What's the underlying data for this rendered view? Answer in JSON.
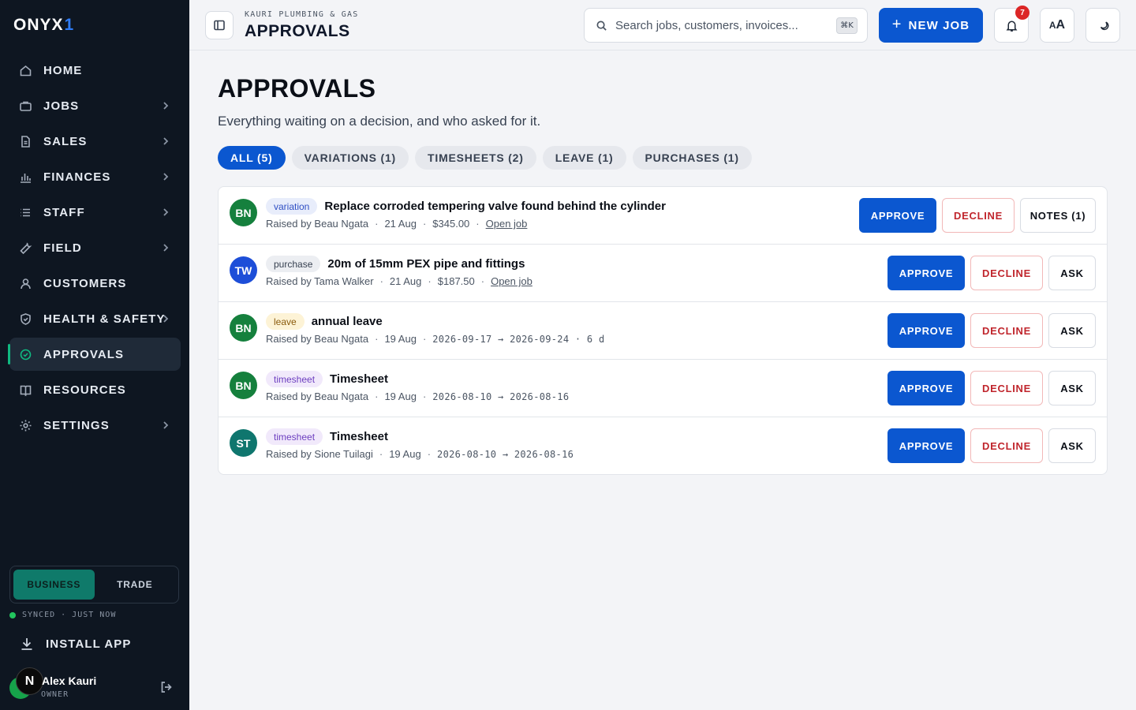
{
  "sidebar": {
    "logo": {
      "text": "ONYX",
      "accent": "1"
    },
    "items": [
      {
        "label": "HOME",
        "icon": "home-icon",
        "chevron": false,
        "active": false
      },
      {
        "label": "JOBS",
        "icon": "briefcase-icon",
        "chevron": true,
        "active": false
      },
      {
        "label": "SALES",
        "icon": "document-icon",
        "chevron": true,
        "active": false
      },
      {
        "label": "FINANCES",
        "icon": "bar-chart-icon",
        "chevron": true,
        "active": false
      },
      {
        "label": "STAFF",
        "icon": "list-icon",
        "chevron": true,
        "active": false
      },
      {
        "label": "FIELD",
        "icon": "wrench-icon",
        "chevron": true,
        "active": false
      },
      {
        "label": "CUSTOMERS",
        "icon": "user-icon",
        "chevron": false,
        "active": false
      },
      {
        "label": "HEALTH & SAFETY",
        "icon": "shield-icon",
        "chevron": true,
        "active": false
      },
      {
        "label": "APPROVALS",
        "icon": "check-circle-icon",
        "chevron": false,
        "active": true
      },
      {
        "label": "RESOURCES",
        "icon": "book-icon",
        "chevron": false,
        "active": false
      },
      {
        "label": "SETTINGS",
        "icon": "gear-icon",
        "chevron": true,
        "active": false
      }
    ],
    "mode": {
      "business": "BUSINESS",
      "trade": "TRADE",
      "selected": "BUSINESS"
    },
    "sync_status": "SYNCED · JUST NOW",
    "install_label": "INSTALL APP",
    "user": {
      "name": "Alex Kauri",
      "role": "OWNER",
      "badge": "N"
    }
  },
  "topbar": {
    "company": "KAURI PLUMBING & GAS",
    "title": "APPROVALS",
    "search_placeholder": "Search jobs, customers, invoices...",
    "search_shortcut": "⌘K",
    "new_job_label": "NEW JOB",
    "notification_count": "7",
    "text_size_label_small": "A",
    "text_size_label_big": "A"
  },
  "page": {
    "title": "APPROVALS",
    "subtitle": "Everything waiting on a decision, and who asked for it.",
    "tabs": [
      {
        "label": "ALL (5)",
        "selected": true
      },
      {
        "label": "VARIATIONS (1)",
        "selected": false
      },
      {
        "label": "TIMESHEETS (2)",
        "selected": false
      },
      {
        "label": "LEAVE (1)",
        "selected": false
      },
      {
        "label": "PURCHASES (1)",
        "selected": false
      }
    ]
  },
  "approvals": [
    {
      "initials": "BN",
      "avatar_color": "#15803d",
      "tag": "variation",
      "tag_bg": "#e8edfb",
      "tag_color": "#2f4fc4",
      "title": "Replace corroded tempering valve found behind the cylinder",
      "raised_by": "Raised by Beau Ngata",
      "date": "21 Aug",
      "detail": "$345.00",
      "link": "Open job",
      "approve": "APPROVE",
      "decline": "DECLINE",
      "third": "NOTES (1)",
      "third_kind": "notes"
    },
    {
      "initials": "TW",
      "avatar_color": "#1d4ed8",
      "tag": "purchase",
      "tag_bg": "#eceef2",
      "tag_color": "#374151",
      "title": "20m of 15mm PEX pipe and fittings",
      "raised_by": "Raised by Tama Walker",
      "date": "21 Aug",
      "detail": "$187.50",
      "link": "Open job",
      "approve": "APPROVE",
      "decline": "DECLINE",
      "third": "ASK",
      "third_kind": "ask"
    },
    {
      "initials": "BN",
      "avatar_color": "#15803d",
      "tag": "leave",
      "tag_bg": "#fdf3d6",
      "tag_color": "#8a5a0b",
      "title": "annual leave",
      "raised_by": "Raised by Beau Ngata",
      "date": "19 Aug",
      "detail": "2026-09-17 → 2026-09-24 · 6 d",
      "link": "",
      "approve": "APPROVE",
      "decline": "DECLINE",
      "third": "ASK",
      "third_kind": "ask"
    },
    {
      "initials": "BN",
      "avatar_color": "#15803d",
      "tag": "timesheet",
      "tag_bg": "#f1e9fb",
      "tag_color": "#6d3fc0",
      "title": "Timesheet",
      "raised_by": "Raised by Beau Ngata",
      "date": "19 Aug",
      "detail": "2026-08-10 → 2026-08-16",
      "link": "",
      "approve": "APPROVE",
      "decline": "DECLINE",
      "third": "ASK",
      "third_kind": "ask"
    },
    {
      "initials": "ST",
      "avatar_color": "#0f766e",
      "tag": "timesheet",
      "tag_bg": "#f1e9fb",
      "tag_color": "#6d3fc0",
      "title": "Timesheet",
      "raised_by": "Raised by Sione Tuilagi",
      "date": "19 Aug",
      "detail": "2026-08-10 → 2026-08-16",
      "link": "",
      "approve": "APPROVE",
      "decline": "DECLINE",
      "third": "ASK",
      "third_kind": "ask"
    }
  ],
  "colors": {
    "accent": "#0b57d0",
    "sidebar_bg": "#0e1621",
    "active_marker": "#10b981",
    "decline": "#c0262d"
  }
}
